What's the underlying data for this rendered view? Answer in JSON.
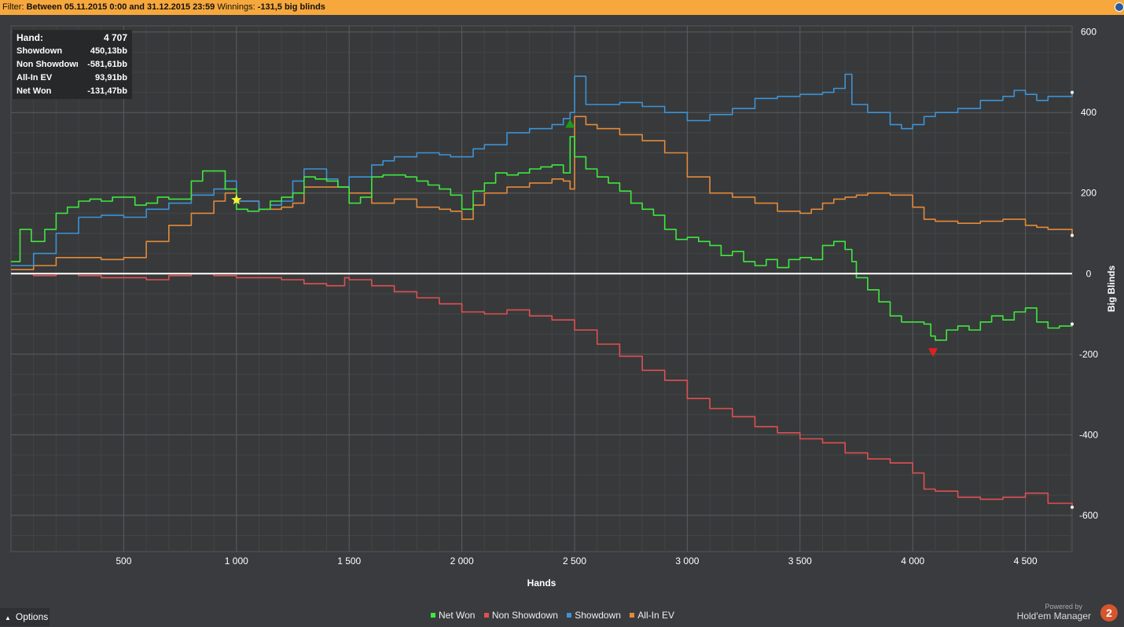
{
  "filter_bar": {
    "prefix": "Filter:",
    "range": "Between 05.11.2015 0:00 and 31.12.2015 23:59",
    "winnings_label": "Winnings:",
    "winnings_value": "-131,5 big blinds"
  },
  "stats": [
    {
      "label": "Hand:",
      "value": "4 707"
    },
    {
      "label": "Showdown",
      "value": "450,13bb"
    },
    {
      "label": "Non Showdown",
      "value": "-581,61bb"
    },
    {
      "label": "All-In EV",
      "value": "93,91bb"
    },
    {
      "label": "Net Won",
      "value": "-131,47bb"
    }
  ],
  "options_label": "Options",
  "brand": {
    "powered": "Powered by",
    "name": "Hold'em Manager",
    "logo": "2"
  },
  "chart_data": {
    "type": "line",
    "xlabel": "Hands",
    "ylabel": "Big Blinds",
    "xlim": [
      0,
      4707
    ],
    "ylim": [
      -690,
      615
    ],
    "x_ticks": [
      500,
      1000,
      1500,
      2000,
      2500,
      3000,
      3500,
      4000,
      4500
    ],
    "x_tick_labels": [
      "500",
      "1 000",
      "1 500",
      "2 000",
      "2 500",
      "3 000",
      "3 500",
      "4 000",
      "4 500"
    ],
    "y_ticks": [
      600,
      400,
      200,
      0,
      -200,
      -400,
      -600
    ],
    "y_tick_labels": [
      "600",
      "400",
      "200",
      "0",
      "-200",
      "-400",
      "-600"
    ],
    "grid": true,
    "legend_position": "bottom-center",
    "series": [
      {
        "name": "Net Won",
        "color": "#3ee83e",
        "x": [
          0,
          40,
          90,
          150,
          200,
          250,
          300,
          350,
          400,
          450,
          500,
          550,
          600,
          650,
          700,
          750,
          800,
          850,
          900,
          950,
          1000,
          1050,
          1100,
          1150,
          1200,
          1250,
          1300,
          1350,
          1400,
          1450,
          1500,
          1550,
          1600,
          1650,
          1700,
          1750,
          1800,
          1850,
          1900,
          1950,
          2000,
          2050,
          2100,
          2150,
          2200,
          2250,
          2300,
          2350,
          2400,
          2450,
          2480,
          2500,
          2550,
          2600,
          2650,
          2700,
          2750,
          2800,
          2850,
          2900,
          2950,
          3000,
          3050,
          3100,
          3150,
          3200,
          3250,
          3300,
          3350,
          3400,
          3450,
          3500,
          3550,
          3600,
          3650,
          3700,
          3730,
          3750,
          3800,
          3850,
          3900,
          3950,
          4000,
          4050,
          4080,
          4100,
          4150,
          4200,
          4250,
          4300,
          4350,
          4400,
          4450,
          4500,
          4550,
          4600,
          4650,
          4707
        ],
        "y": [
          30,
          110,
          80,
          110,
          150,
          165,
          180,
          185,
          180,
          190,
          190,
          170,
          175,
          190,
          185,
          185,
          230,
          255,
          255,
          210,
          160,
          155,
          160,
          180,
          190,
          200,
          240,
          235,
          230,
          215,
          175,
          190,
          240,
          245,
          245,
          240,
          230,
          220,
          210,
          195,
          160,
          205,
          225,
          250,
          245,
          250,
          260,
          265,
          270,
          250,
          340,
          290,
          260,
          240,
          225,
          205,
          175,
          160,
          145,
          110,
          85,
          90,
          80,
          70,
          45,
          55,
          30,
          20,
          35,
          15,
          35,
          40,
          35,
          70,
          80,
          60,
          30,
          -10,
          -40,
          -70,
          -105,
          -120,
          -120,
          -125,
          -155,
          -165,
          -140,
          -130,
          -140,
          -120,
          -105,
          -115,
          -95,
          -85,
          -120,
          -135,
          -130,
          -125
        ]
      },
      {
        "name": "Non Showdown",
        "color": "#e05050",
        "x": [
          0,
          100,
          200,
          300,
          400,
          500,
          600,
          700,
          800,
          900,
          1000,
          1100,
          1200,
          1300,
          1400,
          1480,
          1500,
          1600,
          1700,
          1800,
          1900,
          2000,
          2100,
          2200,
          2300,
          2400,
          2500,
          2600,
          2700,
          2800,
          2900,
          3000,
          3100,
          3200,
          3300,
          3400,
          3500,
          3600,
          3700,
          3800,
          3900,
          4000,
          4050,
          4100,
          4200,
          4300,
          4400,
          4500,
          4600,
          4707
        ],
        "y": [
          0,
          -5,
          0,
          -5,
          -10,
          -10,
          -15,
          -5,
          0,
          -5,
          -10,
          -10,
          -15,
          -25,
          -30,
          -10,
          -15,
          -30,
          -45,
          -60,
          -75,
          -95,
          -100,
          -90,
          -105,
          -115,
          -140,
          -175,
          -205,
          -240,
          -265,
          -310,
          -335,
          -355,
          -380,
          -395,
          -410,
          -420,
          -445,
          -460,
          -470,
          -495,
          -535,
          -540,
          -555,
          -560,
          -555,
          -545,
          -570,
          -580
        ]
      },
      {
        "name": "Showdown",
        "color": "#3a94d8",
        "x": [
          0,
          100,
          200,
          300,
          400,
          500,
          600,
          700,
          800,
          900,
          950,
          1000,
          1100,
          1150,
          1200,
          1250,
          1300,
          1400,
          1450,
          1500,
          1600,
          1650,
          1700,
          1800,
          1900,
          1950,
          2000,
          2050,
          2100,
          2200,
          2300,
          2400,
          2450,
          2480,
          2500,
          2550,
          2600,
          2700,
          2800,
          2900,
          3000,
          3100,
          3200,
          3300,
          3400,
          3500,
          3600,
          3650,
          3700,
          3730,
          3800,
          3900,
          3950,
          4000,
          4050,
          4100,
          4200,
          4300,
          4400,
          4450,
          4500,
          4550,
          4600,
          4707
        ],
        "y": [
          20,
          50,
          100,
          140,
          145,
          140,
          160,
          175,
          195,
          210,
          230,
          180,
          160,
          170,
          180,
          230,
          260,
          235,
          215,
          240,
          270,
          280,
          290,
          300,
          295,
          290,
          290,
          310,
          320,
          350,
          360,
          370,
          385,
          400,
          490,
          420,
          420,
          425,
          415,
          400,
          380,
          395,
          410,
          435,
          440,
          445,
          450,
          460,
          495,
          420,
          400,
          370,
          360,
          370,
          390,
          400,
          410,
          430,
          440,
          455,
          445,
          430,
          440,
          450
        ]
      },
      {
        "name": "All-In EV",
        "color": "#e48a3a",
        "x": [
          0,
          100,
          200,
          300,
          400,
          500,
          600,
          700,
          800,
          900,
          950,
          1000,
          1100,
          1200,
          1250,
          1300,
          1400,
          1500,
          1600,
          1700,
          1800,
          1900,
          1950,
          2000,
          2050,
          2100,
          2200,
          2300,
          2400,
          2450,
          2480,
          2500,
          2550,
          2600,
          2700,
          2800,
          2900,
          3000,
          3100,
          3200,
          3300,
          3400,
          3500,
          3550,
          3600,
          3650,
          3700,
          3750,
          3800,
          3900,
          4000,
          4050,
          4100,
          4200,
          4300,
          4400,
          4500,
          4550,
          4600,
          4707
        ],
        "y": [
          10,
          20,
          40,
          40,
          35,
          40,
          80,
          120,
          150,
          180,
          200,
          180,
          160,
          165,
          175,
          215,
          215,
          200,
          175,
          185,
          165,
          160,
          155,
          135,
          170,
          200,
          215,
          225,
          235,
          230,
          210,
          390,
          370,
          360,
          345,
          330,
          300,
          240,
          200,
          190,
          175,
          155,
          150,
          160,
          175,
          185,
          190,
          195,
          200,
          195,
          165,
          135,
          130,
          125,
          130,
          135,
          120,
          115,
          110,
          95
        ]
      }
    ],
    "markers": [
      {
        "type": "star",
        "x": 1000,
        "y": 183,
        "color": "#f2f232"
      },
      {
        "type": "triangle-up",
        "x": 2480,
        "y": 372,
        "color": "#1d9a1d"
      },
      {
        "type": "triangle-down",
        "x": 4090,
        "y": -195,
        "color": "#e02020"
      }
    ]
  }
}
